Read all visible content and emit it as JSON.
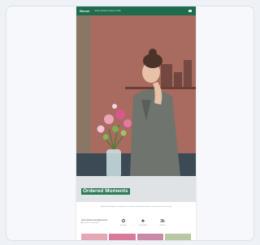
{
  "header": {
    "brand": "Bloom",
    "nav": "Shop  Flowers  Plants  Gifts"
  },
  "hero": {
    "title": "Ordered Moments",
    "subtitle": "Fresh flowers delivered to your door"
  },
  "intro": {
    "text": "Hand-tied bouquets arranged by our florists and delivered fresh, same day across the city."
  },
  "features": {
    "heading": "Just-picked arrangements",
    "subheading": "All season, every day",
    "items": [
      {
        "icon": "flower-icon",
        "glyph": "✿",
        "label": "Arranged"
      },
      {
        "icon": "leaf-icon",
        "glyph": "♣",
        "label": "Sustainable"
      },
      {
        "icon": "number-badge",
        "glyph": "3k",
        "label": "Reviews"
      }
    ]
  },
  "colors": {
    "brand": "#1f6b4e",
    "hero_wall": "#a8695f",
    "thumb_1": "#e6a7b5",
    "thumb_2": "#d97a9a",
    "thumb_3": "#c98aa7",
    "thumb_4": "#b9c7a3"
  }
}
